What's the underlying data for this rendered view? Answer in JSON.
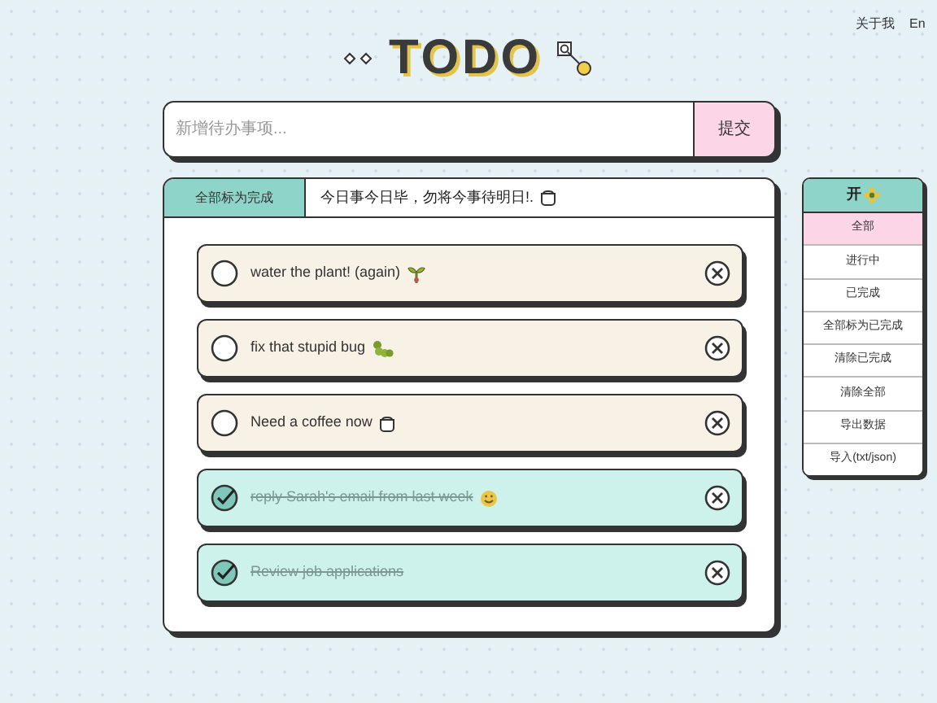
{
  "nav": {
    "links": [
      "关于我",
      "En"
    ]
  },
  "logo": {
    "text": "TODO"
  },
  "new_todo": {
    "placeholder": "新增待办事项...",
    "submit": "提交"
  },
  "toolbar": {
    "mark_all": "全部标为完成",
    "motto": "今日事今日毕，勿将今事待明日!."
  },
  "todos": [
    {
      "text": "water the plant! (again)",
      "done": false
    },
    {
      "text": "fix that stupid bug",
      "done": false
    },
    {
      "text": "Need a coffee now",
      "done": false
    },
    {
      "text": "reply Sarah's email from last week",
      "done": true
    },
    {
      "text": "Review job applications",
      "done": true
    }
  ],
  "menu": {
    "title": "开",
    "items": [
      {
        "label": "全部",
        "selected": true
      },
      {
        "label": "进行中",
        "selected": false
      },
      {
        "label": "已完成",
        "selected": false
      },
      {
        "label": "全部标为已完成",
        "selected": false
      },
      {
        "label": "清除已完成",
        "selected": false
      },
      {
        "label": "清除全部",
        "selected": false
      },
      {
        "label": "导出数据",
        "selected": false
      },
      {
        "label": "导入(txt/json)",
        "selected": false
      }
    ]
  }
}
